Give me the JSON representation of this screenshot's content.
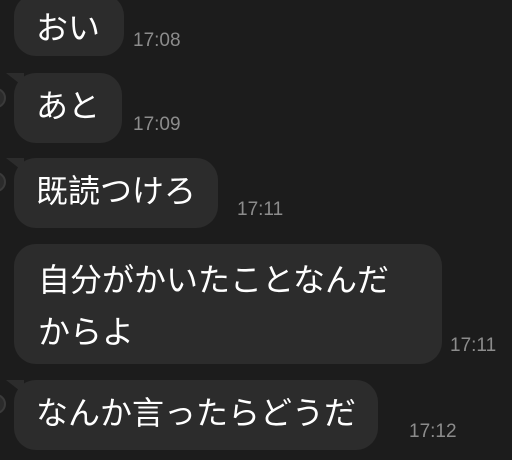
{
  "messages": [
    {
      "text": "おい",
      "time": "17:08"
    },
    {
      "text": "あと",
      "time": "17:09"
    },
    {
      "text": "既読つけろ",
      "time": "17:11"
    },
    {
      "lines": [
        "自分がかいたことなんだ",
        "からよ"
      ],
      "time": "17:11"
    },
    {
      "text": "なんか言ったらどうだ",
      "time": "17:12"
    }
  ],
  "colors": {
    "background": "#1c1c1c",
    "bubble": "#2c2c2c",
    "text": "#ffffff",
    "timestamp": "#8c8c8c"
  }
}
